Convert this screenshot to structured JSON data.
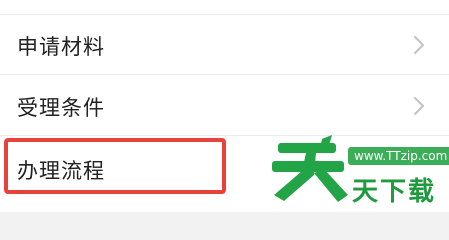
{
  "list": {
    "items": [
      {
        "label": "申请材料",
        "has_chevron": true
      },
      {
        "label": "受理条件",
        "has_chevron": true
      },
      {
        "label": "办理流程",
        "has_chevron": false
      }
    ]
  },
  "watermark": {
    "url": "www.TTzip.com",
    "text": "天下载"
  },
  "colors": {
    "highlight": "#e8423d",
    "watermark_green": "#1f9a3e",
    "text": "#222222",
    "chevron": "#c4c4c4"
  },
  "icons": {
    "chevron": "chevron-right-icon",
    "logo": "tian-logo-icon"
  }
}
